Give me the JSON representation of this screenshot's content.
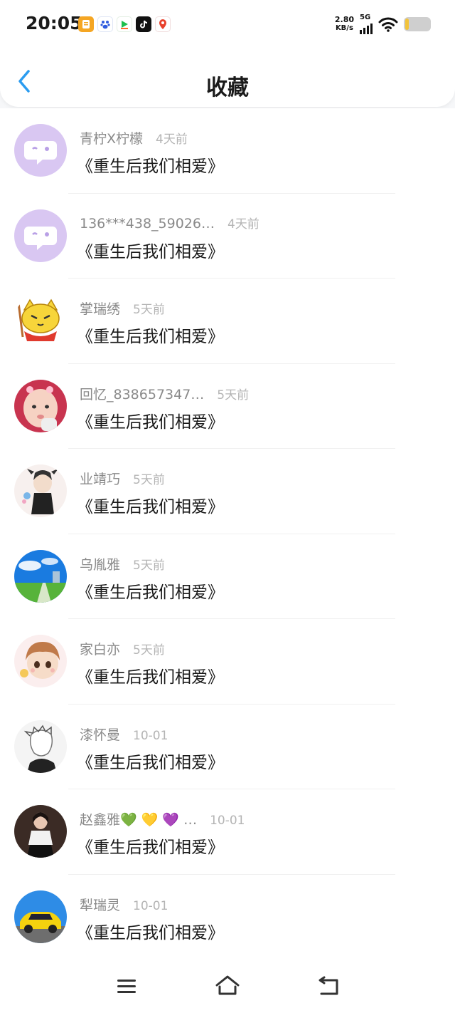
{
  "status_bar": {
    "time": "20:05",
    "net_speed_value": "2.80",
    "net_speed_unit": "KB/s",
    "network_type": "5G",
    "app_icons": [
      "notes-app-icon",
      "baidu-app-icon",
      "video-app-icon",
      "tiktok-app-icon",
      "map-app-icon"
    ],
    "battery_level": 0.15
  },
  "header": {
    "title": "收藏",
    "back_icon": "chevron-left-icon",
    "accent_color": "#2b9cf0"
  },
  "favorites": [
    {
      "username": "青柠X柠檬",
      "time": "4天前",
      "content": "《重生后我们相爱》",
      "avatar": "default-chat-avatar"
    },
    {
      "username": "136***438_59026…",
      "time": "4天前",
      "content": "《重生后我们相爱》",
      "avatar": "default-chat-avatar"
    },
    {
      "username": "掌瑞绣",
      "time": "5天前",
      "content": "《重生后我们相爱》",
      "avatar": "yellow-cat-avatar"
    },
    {
      "username": "回忆_838657347…",
      "time": "5天前",
      "content": "《重生后我们相爱》",
      "avatar": "baby-photo-avatar"
    },
    {
      "username": "业靖巧",
      "time": "5天前",
      "content": "《重生后我们相爱》",
      "avatar": "anime-character-avatar"
    },
    {
      "username": "乌胤雅",
      "time": "5天前",
      "content": "《重生后我们相爱》",
      "avatar": "landscape-avatar"
    },
    {
      "username": "家白亦",
      "time": "5天前",
      "content": "《重生后我们相爱》",
      "avatar": "anime-girl-avatar"
    },
    {
      "username": "漆怀曼",
      "time": "10-01",
      "content": "《重生后我们相爱》",
      "avatar": "sketch-avatar"
    },
    {
      "username": "赵鑫雅💚 💛 💜 …",
      "time": "10-01",
      "content": "《重生后我们相爱》",
      "avatar": "girl-photo-avatar"
    },
    {
      "username": "犁瑞灵",
      "time": "10-01",
      "content": "《重生后我们相爱》",
      "avatar": "yellow-car-avatar"
    }
  ],
  "bottom_nav": {
    "menu_icon": "menu-icon",
    "home_icon": "home-icon",
    "back_icon": "back-icon"
  }
}
